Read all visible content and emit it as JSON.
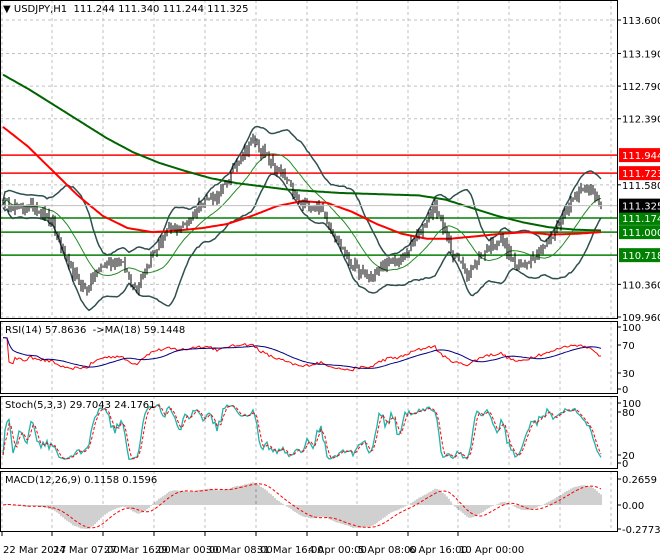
{
  "chart_data": {
    "type": "candlestick",
    "symbol_header": "USDJPY,H1",
    "ohlc_header": "111.244 111.340 111.244 111.325",
    "price_ticks": [
      "113.600",
      "113.190",
      "112.790",
      "112.390",
      "111.580",
      "110.360",
      "109.960"
    ],
    "price_range": [
      109.96,
      113.6
    ],
    "close_path": [
      111.39,
      111.27,
      111.33,
      111.09,
      110.54,
      110.3,
      110.6,
      110.66,
      110.3,
      110.73,
      111.03,
      111.09,
      111.39,
      111.45,
      111.82,
      112.13,
      111.88,
      111.64,
      111.33,
      111.33,
      110.97,
      110.6,
      110.42,
      110.6,
      110.66,
      110.97,
      111.33,
      110.78,
      110.48,
      110.78,
      110.91,
      110.54,
      110.73,
      110.91,
      111.33,
      111.58,
      111.325
    ],
    "ma_slow_path": [
      112.93,
      112.75,
      112.55,
      112.35,
      112.15,
      111.98,
      111.85,
      111.75,
      111.66,
      111.6,
      111.56,
      111.52,
      111.5,
      111.48,
      111.47,
      111.46,
      111.45,
      111.4,
      111.3,
      111.2,
      111.12,
      111.06,
      111.03,
      111.02
    ],
    "ma_fast_path": [
      112.29,
      112.05,
      111.75,
      111.45,
      111.2,
      111.05,
      111.0,
      111.02,
      111.05,
      111.1,
      111.2,
      111.32,
      111.38,
      111.36,
      111.25,
      111.1,
      110.98,
      110.92,
      110.92,
      110.95,
      110.98,
      111.0,
      110.97,
      110.98,
      111.0
    ],
    "last_price": {
      "label": "111.325",
      "value": 111.325,
      "color": "#000000"
    },
    "levels": [
      {
        "label": "111.944",
        "value": 111.944,
        "color": "#ff0000"
      },
      {
        "label": "111.723",
        "value": 111.723,
        "color": "#ff0000"
      },
      {
        "label": "111.174",
        "value": 111.174,
        "color": "#008000"
      },
      {
        "label": "111.000",
        "value": 111.0,
        "color": "#008000"
      },
      {
        "label": "110.718",
        "value": 110.718,
        "color": "#008000"
      }
    ],
    "time_labels": [
      "22 Mar 2017",
      "24 Mar 07:00",
      "27 Mar 16:00",
      "29 Mar 00:00",
      "30 Mar 08:00",
      "31 Mar 16:00",
      "4 Apr 00:00",
      "5 Apr 08:00",
      "6 Apr 16:00",
      "10 Apr 00:00"
    ],
    "rsi": {
      "header": "RSI(14) 57.8636  ->MA(18) 59.1448",
      "ticks": [
        "100",
        "70",
        "30",
        "0"
      ],
      "color": "#ff0000",
      "ma_color": "#000080"
    },
    "stoch": {
      "header": "Stoch(5,3,3) 29.7043 24.1761",
      "ticks": [
        "100",
        "80",
        "20",
        "0"
      ],
      "main_color": "#20b2aa",
      "signal_color": "#ff0000"
    },
    "macd": {
      "header": "MACD(12,26,9) 0.1158 0.1596",
      "ticks": [
        "0.2659",
        "0.00",
        "-0.2773"
      ],
      "hist_color": "#a0a0a0",
      "signal_color": "#ff0000"
    },
    "colors": {
      "candle": "#000000",
      "bands": "#2f4f4f",
      "ma_slow": "#006400",
      "ma_fast": "#ff0000",
      "grid": "#c0c0c0"
    }
  }
}
